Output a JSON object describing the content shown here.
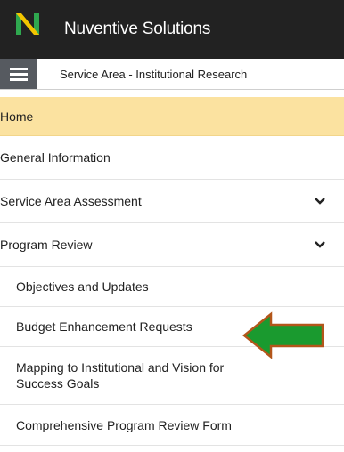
{
  "header": {
    "app_title": "Nuventive Solutions",
    "logo_icon": "nuventive-n-logo",
    "background": "#222222",
    "logo_colors": [
      "#2fa84f",
      "#f2c500"
    ]
  },
  "context_bar": {
    "menu_icon": "hamburger-menu-icon",
    "label": "Service Area - Institutional Research"
  },
  "nav": {
    "items": [
      {
        "label": "Home",
        "active": true,
        "expandable": false,
        "level": 1
      },
      {
        "label": "General Information",
        "active": false,
        "expandable": false,
        "level": 1
      },
      {
        "label": "Service Area Assessment",
        "active": false,
        "expandable": true,
        "level": 1
      },
      {
        "label": "Program Review",
        "active": false,
        "expandable": true,
        "level": 1
      },
      {
        "label": "Objectives and Updates",
        "active": false,
        "expandable": false,
        "level": 2
      },
      {
        "label": "Budget Enhancement Requests",
        "active": false,
        "expandable": false,
        "level": 2
      },
      {
        "label": "Mapping to Institutional and Vision for Success Goals",
        "active": false,
        "expandable": false,
        "level": 2
      },
      {
        "label": "Comprehensive Program Review Form",
        "active": false,
        "expandable": false,
        "level": 2
      }
    ],
    "active_color": "#fbe2a0"
  },
  "annotation": {
    "icon": "green-arrow-pointer",
    "color": "#1a9a2f",
    "outline": "#b3561a"
  }
}
